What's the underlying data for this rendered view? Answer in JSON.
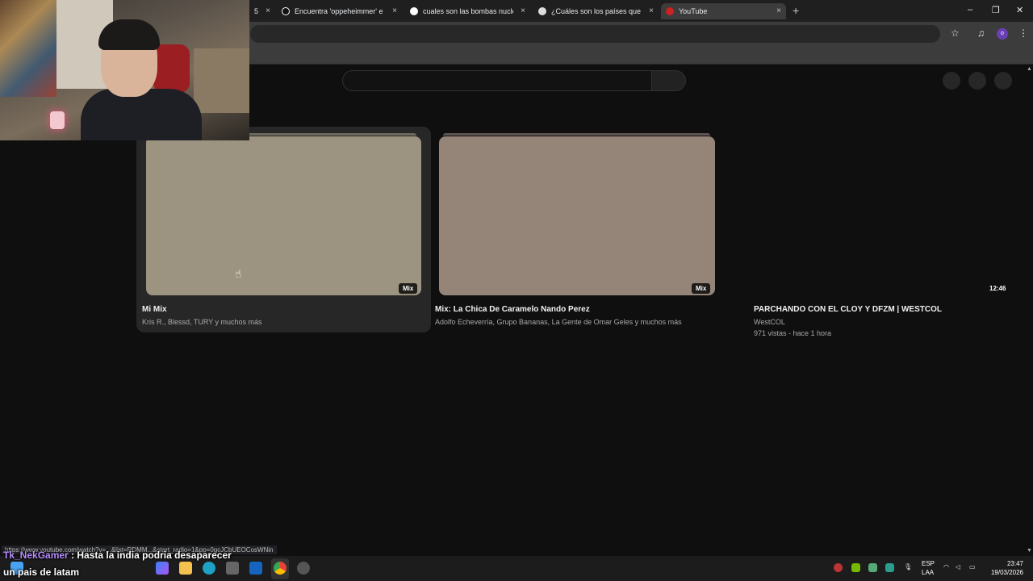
{
  "browser": {
    "tabs": [
      {
        "title": "5",
        "active": false
      },
      {
        "title": "Encuentra 'oppeheimmer' en TikTok",
        "active": false
      },
      {
        "title": "cuales son las bombas nucleares",
        "active": false
      },
      {
        "title": "¿Cuáles son los países que tienen",
        "active": false
      },
      {
        "title": "YouTube",
        "active": true
      }
    ],
    "close_glyph": "×",
    "new_tab_glyph": "+",
    "window_controls": {
      "minimize": "–",
      "restore": "❐",
      "close": "✕"
    },
    "toolbar_icons": {
      "star": "☆",
      "media": "♫",
      "profile_initial": "o",
      "menu": "⋮"
    },
    "status_url": "https://www.youtube.com/watch?v=...&list=RDMM...&start_radio=1&pp=0gcJCbUEOCosWNin"
  },
  "youtube": {
    "cards": [
      {
        "title": "Mi Mix",
        "meta": "Kris R., Blessd, TURY y muchos más",
        "badge": "Mix",
        "thumb_color": "#9c9480"
      },
      {
        "title": "Mix: La Chica De Caramelo  Nando Perez",
        "meta": "Adolfo Echeverría, Grupo Bananas, La Gente de Omar Geles y muchos más",
        "badge": "Mix",
        "thumb_color": "#958579"
      },
      {
        "title": "PARCHANDO CON EL CLOY Y DFZM | WESTCOL",
        "channel": "WestCOL",
        "meta": "971 vistas - hace 1 hora",
        "badge": "12:46",
        "thumb_color": "#0f0f0f"
      }
    ]
  },
  "chat": {
    "username": "Tk_NekGamer",
    "separator": " : ",
    "message_line1": "Hasta la india podria desaparecer",
    "message_line2": "un pais de latam"
  },
  "taskbar": {
    "tray_lang": "ESP",
    "tray_region": "LAA",
    "time": "23:47",
    "date": "19/03/2026"
  },
  "colors": {
    "background": "#0f0f0f",
    "chat_username": "#b78cff",
    "accent_red": "#ff0000"
  }
}
